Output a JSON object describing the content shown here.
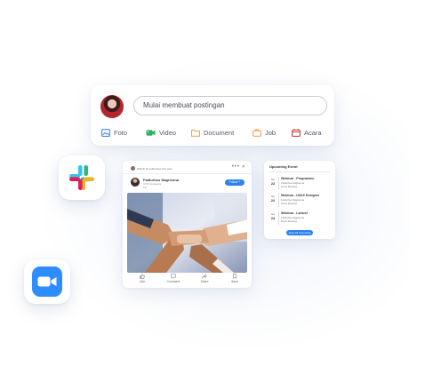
{
  "composer": {
    "placeholder": "Mulai membuat postingan",
    "actions": [
      {
        "label": "Foto",
        "icon": "image-icon",
        "color": "#2f80ed"
      },
      {
        "label": "Video",
        "icon": "video-icon",
        "color": "#27ae60"
      },
      {
        "label": "Document",
        "icon": "folder-icon",
        "color": "#e0a33a"
      },
      {
        "label": "Job",
        "icon": "briefcase-icon",
        "color": "#f2994a"
      },
      {
        "label": "Acara",
        "icon": "calendar-icon",
        "color": "#c0392b"
      }
    ]
  },
  "post": {
    "liked_by": "Maftuh Novellia likes this post",
    "author": "Fadlurhus Nagrienna",
    "author_meta": "CTO Company",
    "author_time": "1m",
    "follow_label": "Follow +",
    "footer": [
      {
        "label": "Like",
        "icon": "thumbs-up-icon"
      },
      {
        "label": "Comment",
        "icon": "comment-icon"
      },
      {
        "label": "Share",
        "icon": "share-icon"
      },
      {
        "label": "Save",
        "icon": "bookmark-icon"
      }
    ]
  },
  "events": {
    "title": "Upcoming Event",
    "items": [
      {
        "month": "Nov",
        "day": "22",
        "title": "Webinar - Programme",
        "host": "Fadlurhus Nagrienna",
        "type": "Zoom Meeting"
      },
      {
        "month": "Nov",
        "day": "22",
        "title": "Webinar - UI/UX Designer",
        "host": "Fadlurhus Nagrienna",
        "type": "Zoom Meeting"
      },
      {
        "month": "Nov",
        "day": "24",
        "title": "Webinar - Laravel",
        "host": "Fadlurhus Nagrienna",
        "type": "Zoom Meeting"
      }
    ],
    "view_all_label": "View All Upcoming"
  },
  "apps": {
    "slack_icon": "slack-logo-icon",
    "zoom_icon": "zoom-logo-icon",
    "zoom_color": "#2d8cff"
  }
}
